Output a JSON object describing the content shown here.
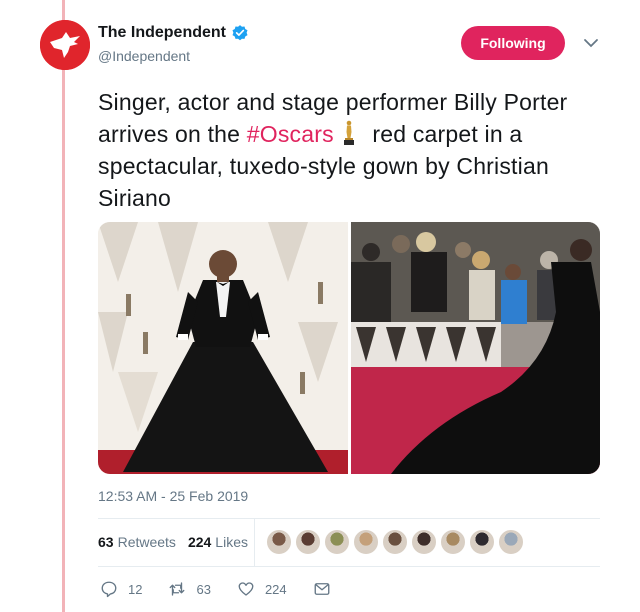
{
  "account": {
    "display_name": "The Independent",
    "handle": "@Independent",
    "verified": true,
    "avatar_icon": "eagle-logo-icon",
    "brand_color": "#e0252c"
  },
  "follow_button": {
    "label": "Following",
    "color": "#e0245e"
  },
  "tweet": {
    "text_before": "Singer, actor and stage performer Billy Porter arrives on the ",
    "hashtag": "#Oscars",
    "emoji": "oscar-trophy-icon",
    "text_after": " red carpet in a spectacular, tuxedo-style gown by Christian Siriano",
    "hashtag_color": "#e0245e"
  },
  "timestamp": "12:53 AM - 25 Feb 2019",
  "stats": {
    "retweets_count": "63",
    "retweets_label": "Retweets",
    "likes_count": "224",
    "likes_label": "Likes"
  },
  "likers": [
    "#7a5a48",
    "#5b3d33",
    "#8c8f55",
    "#c4a07a",
    "#6a5040",
    "#3e2e2a",
    "#a88a62",
    "#2e2a30",
    "#9aa8b8"
  ],
  "actions": {
    "reply_count": "12",
    "retweet_count": "63",
    "like_count": "224"
  }
}
